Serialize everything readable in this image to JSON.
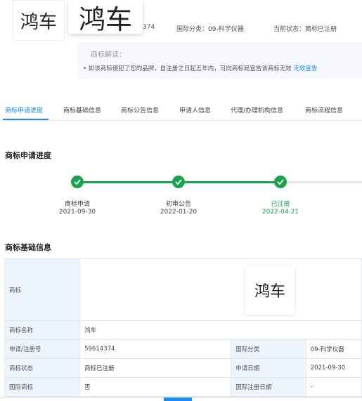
{
  "header": {
    "thumb_text_small": "鸿车",
    "thumb_text_large": "鸿车",
    "reg_partial": "374",
    "intl_class": "国际分类：09-科学仪器",
    "status": "当前状态：商标已注册"
  },
  "interpretation": {
    "title": "商标解读：",
    "text": "• 如该商标侵犯了您的品牌，自注册之日起五年内，可向商标局宣告该商标无效",
    "link": "无效宣告"
  },
  "tabs": [
    {
      "label": "商标申请进度",
      "active": true
    },
    {
      "label": "商标基础信息"
    },
    {
      "label": "商标公告信息"
    },
    {
      "label": "申请人信息"
    },
    {
      "label": "代理/办理机构信息"
    },
    {
      "label": "商标流程信息"
    }
  ],
  "progress": {
    "title": "商标申请进度",
    "steps": [
      {
        "label": "商标申请",
        "date": "2021-09-30"
      },
      {
        "label": "初审公告",
        "date": "2022-01-20"
      },
      {
        "label": "已注册",
        "date": "2022-04-21"
      }
    ]
  },
  "basic": {
    "title": "商标基础信息",
    "rows": {
      "trademark_label": "商标",
      "trademark_image_text": "鸿车",
      "name_label": "商标名称",
      "name_value": "鸿车",
      "reg_label": "申请/注册号",
      "reg_value": "59614374",
      "class_label": "国际分类",
      "class_value": "09-科学仪器",
      "status_label": "商标状态",
      "status_value": "商标已注册",
      "apply_date_label": "申请日期",
      "apply_date_value": "2021-09-30",
      "intl_label": "国际商标",
      "intl_value": "否",
      "intl_reg_date_label": "国际注册日期",
      "intl_reg_date_value": "-"
    }
  },
  "colors": {
    "accent": "#1a8bf0",
    "success": "#1aa34a"
  }
}
